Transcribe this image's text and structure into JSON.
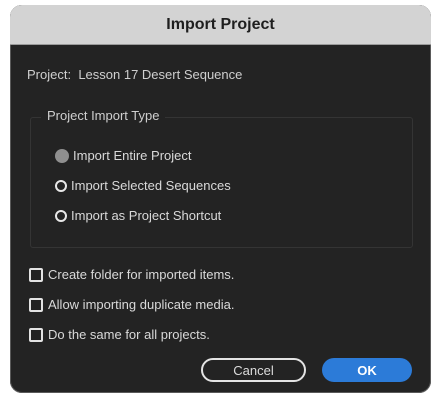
{
  "dialog": {
    "title": "Import Project",
    "project_label": "Project:",
    "project_name": "Lesson 17 Desert Sequence"
  },
  "import_type": {
    "group_title": "Project Import Type",
    "options": [
      {
        "label": "Import Entire Project",
        "selected": true
      },
      {
        "label": "Import Selected Sequences",
        "selected": false
      },
      {
        "label": "Import as Project Shortcut",
        "selected": false
      }
    ]
  },
  "checkboxes": [
    {
      "label": "Create folder for imported items.",
      "checked": false
    },
    {
      "label": "Allow importing duplicate media.",
      "checked": false
    },
    {
      "label": "Do the same for all projects.",
      "checked": false
    }
  ],
  "buttons": {
    "cancel": "Cancel",
    "ok": "OK"
  },
  "colors": {
    "background": "#232323",
    "titlebar": "#d3d3d3",
    "ok_accent": "#2c7bd8"
  }
}
